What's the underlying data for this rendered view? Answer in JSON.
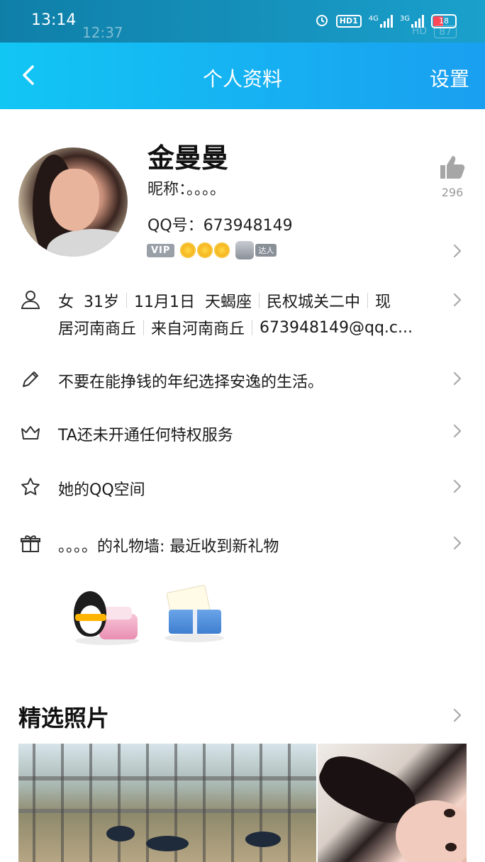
{
  "status_bar": {
    "time": "13:14",
    "time_ghost": "12:37",
    "icons": [
      "alarm-icon",
      "hd-icon",
      "signal-4g-icon",
      "signal-3g-icon",
      "battery-icon"
    ],
    "hd_label": "HD1",
    "net1": "4G",
    "net2": "3G",
    "battery": "18",
    "battery_ghost": "87",
    "hd_ghost": "HD"
  },
  "nav": {
    "title": "个人资料",
    "settings_label": "设置"
  },
  "profile": {
    "name": "金曼曼",
    "nickname": "昵称：。。。。",
    "qq_number": "QQ号：673948149",
    "vip_label": "VIP",
    "daren_label": "达人",
    "likes": "296"
  },
  "info": {
    "line1": [
      "女",
      "31岁",
      "11月1日",
      "天蝎座",
      "民权城关二中",
      "现"
    ],
    "line2": [
      "居河南商丘",
      "来自河南商丘",
      "673948149@qq.c..."
    ]
  },
  "rows": {
    "signature": "不要在能挣钱的年纪选择安逸的生活。",
    "privilege": "TA还未开通任何特权服务",
    "qzone": "她的QQ空间",
    "gift_wall": "。。。。的礼物墙: 最近收到新礼物"
  },
  "photos": {
    "title": "精选照片"
  },
  "colors": {
    "nav_start": "#12c6f4",
    "nav_end": "#1a9ff0",
    "status_bg": "#1495c0",
    "text": "#1a1a1a",
    "muted": "#999999"
  }
}
